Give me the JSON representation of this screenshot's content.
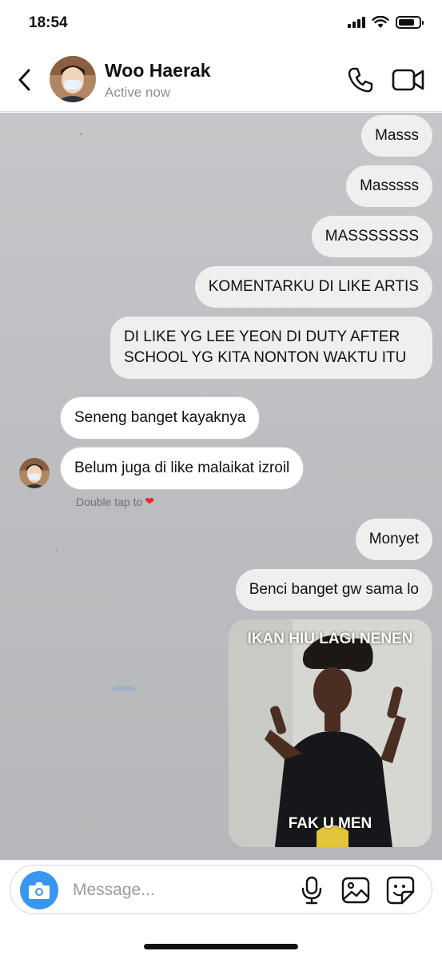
{
  "status_bar": {
    "time": "18:54"
  },
  "header": {
    "contact_name": "Woo Haerak",
    "contact_status": "Active now"
  },
  "messages": [
    {
      "text": "Masss",
      "direction": "outgoing"
    },
    {
      "text": "Masssss",
      "direction": "outgoing"
    },
    {
      "text": "MASSSSSSS",
      "direction": "outgoing"
    },
    {
      "text": "KOMENTARKU DI LIKE ARTIS",
      "direction": "outgoing"
    },
    {
      "text": "DI LIKE YG LEE YEON DI DUTY AFTER SCHOOL YG KITA NONTON WAKTU ITU",
      "direction": "outgoing"
    },
    {
      "text": "Seneng banget kayaknya",
      "direction": "incoming"
    },
    {
      "text": "Belum juga di like malaikat izroil",
      "direction": "incoming"
    },
    {
      "text": "Monyet",
      "direction": "outgoing"
    },
    {
      "text": "Benci banget gw sama lo",
      "direction": "outgoing"
    }
  ],
  "hint": {
    "text": "Double tap to"
  },
  "meme": {
    "top_text": "IKAN HIU LAGI NENEN",
    "bottom_text": "FAK U MEN"
  },
  "composer": {
    "placeholder": "Message..."
  },
  "colors": {
    "accent": "#3797f0",
    "outgoing_bubble": "#efefef",
    "incoming_bubble": "#ffffff",
    "heart": "#e8242c"
  }
}
